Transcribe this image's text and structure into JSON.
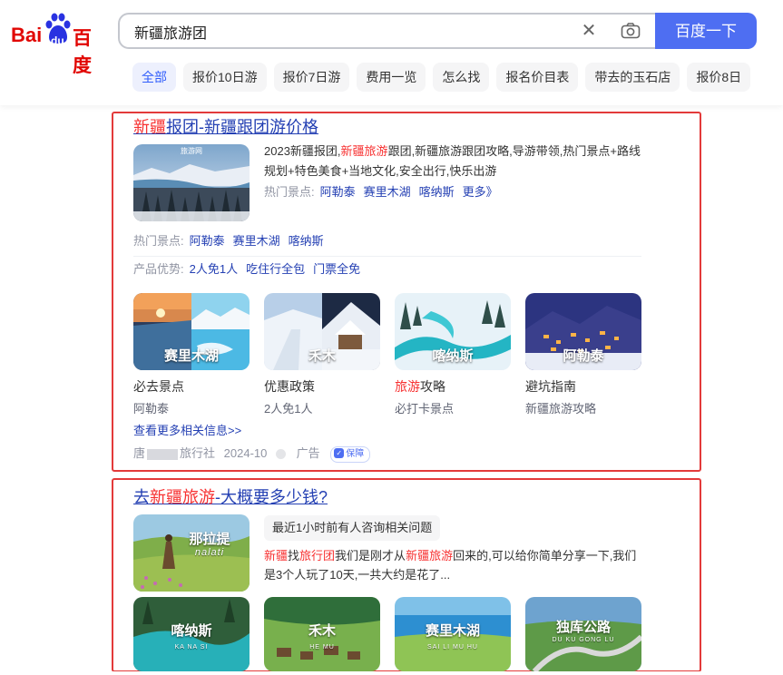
{
  "header": {
    "logo_text_left": "Bai",
    "logo_text_paw": "du",
    "logo_text_right": "百度",
    "search_value": "新疆旅游团",
    "search_button": "百度一下",
    "tabs": [
      "全部",
      "报价10日游",
      "报价7日游",
      "费用一览",
      "怎么找",
      "报名价目表",
      "带去的玉石店",
      "报价8日"
    ]
  },
  "result1": {
    "title_hl": "新疆",
    "title_rest": "报团-新疆跟团游价格",
    "thumb_badge": "旅游网",
    "desc_a": "2023新疆报团,",
    "desc_hl": "新疆旅游",
    "desc_b": "跟团,新疆旅游跟团攻略,导游带领,热门景点+路线",
    "desc_line2": "规划+特色美食+当地文化,安全出行,快乐出游",
    "hot_label": "热门景点:",
    "hot_links": [
      "阿勒泰",
      "赛里木湖",
      "喀纳斯",
      "更多》"
    ],
    "hot_label2": "热门景点:",
    "hot_links2": [
      "阿勒泰",
      "赛里木湖",
      "喀纳斯"
    ],
    "adv_label": "产品优势:",
    "adv_links": [
      "2人免1人",
      "吃住行全包",
      "门票全免"
    ],
    "cards": [
      {
        "label": "赛里木湖",
        "title": "必去景点",
        "sub": "阿勒泰"
      },
      {
        "label": "禾木",
        "title": "优惠政策",
        "sub": "2人免1人"
      },
      {
        "label": "喀纳斯",
        "title_hl": "旅游",
        "title": "攻略",
        "sub": "必打卡景点"
      },
      {
        "label": "阿勒泰",
        "title": "避坑指南",
        "sub": "新疆旅游攻略"
      }
    ],
    "more_link": "查看更多相关信息>>",
    "source_prefix": "唐",
    "source_rest": "旅行社",
    "date": "2024-10",
    "ad": "广告",
    "guarantee": "保障"
  },
  "result2": {
    "title_a": "去",
    "title_hl": "新疆旅游",
    "title_b": "-大概要多少钱?",
    "thumb_label": "那拉提",
    "thumb_sub": "nalati",
    "badge": "最近1小时前有人咨询相关问题",
    "desc_hl1": "新疆",
    "desc_a": "找",
    "desc_hl2": "旅行团",
    "desc_b": "我们是刚才从",
    "desc_hl3": "新疆旅游",
    "desc_c": "回来的,可以给你简单分享一下,我们",
    "desc_line2": "是3个人玩了10天,一共大约是花了...",
    "cards": [
      {
        "label": "喀纳斯",
        "sub": "KA NA SI"
      },
      {
        "label": "禾木",
        "sub": "HE MU"
      },
      {
        "label": "赛里木湖",
        "sub": "SAI LI MU HU"
      },
      {
        "label": "独库公路",
        "sub": "DU KU GONG LU"
      }
    ]
  },
  "colors": {
    "accent": "#4e6ef2",
    "link": "#2440b3",
    "highlight": "#f73131",
    "outline": "#e33a3a"
  }
}
